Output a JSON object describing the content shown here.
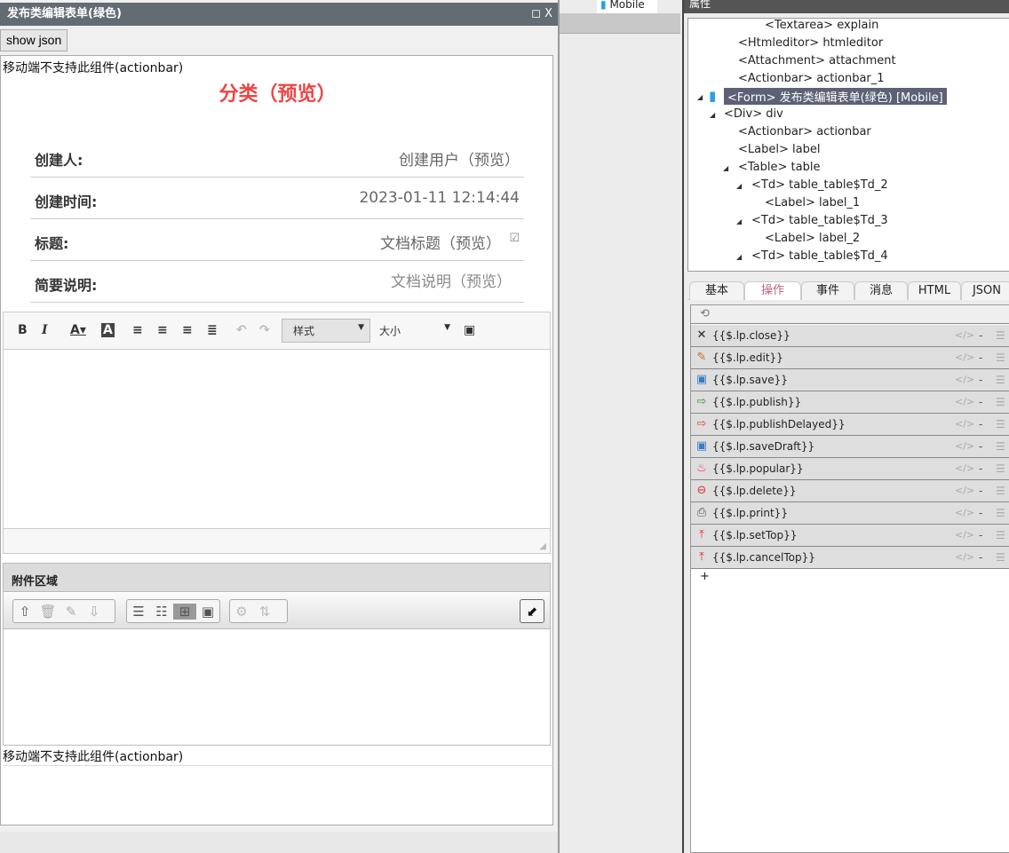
{
  "dialog": {
    "title": "发布类编辑表单(绿色)",
    "controls": "◻ X",
    "show_json": "show json",
    "mobile_note_top": "移动端不支持此组件(actionbar)",
    "mobile_note_bottom": "移动端不支持此组件(actionbar)",
    "category_title": "分类（预览）",
    "rows": [
      {
        "label": "创建人:",
        "value": "创建用户（预览）"
      },
      {
        "label": "创建时间:",
        "value": "2023-01-11 12:14:44"
      },
      {
        "label": "标题:",
        "value": "文档标题（预览）"
      },
      {
        "label": "简要说明:",
        "value": "文档说明（预览）"
      }
    ],
    "editor": {
      "style_label": "样式",
      "size_label": "大小"
    },
    "attachment": {
      "title": "附件区域"
    }
  },
  "mid": {
    "mobile_tab": "Mobile"
  },
  "panel": {
    "title": "属性",
    "tree": [
      "<Textarea> explain",
      "<Htmleditor> htmleditor",
      "<Attachment> attachment",
      "<Actionbar> actionbar_1",
      "<Form> 发布类编辑表单(绿色) [Mobile]",
      "<Div> div",
      "<Actionbar> actionbar",
      "<Label> label",
      "<Table> table",
      "<Td> table_table$Td_2",
      "<Label> label_1",
      "<Td> table_table$Td_3",
      "<Label> label_2",
      "<Td> table_table$Td_4"
    ],
    "tabs": [
      "基本",
      "操作",
      "事件",
      "消息",
      "HTML",
      "JSON"
    ],
    "active_tab": "操作",
    "actions": [
      {
        "name": "{{$.lp.close}}",
        "icon": "close-icon"
      },
      {
        "name": "{{$.lp.edit}}",
        "icon": "pencil-icon"
      },
      {
        "name": "{{$.lp.save}}",
        "icon": "save-icon"
      },
      {
        "name": "{{$.lp.publish}}",
        "icon": "publish-icon"
      },
      {
        "name": "{{$.lp.publishDelayed}}",
        "icon": "publish-delayed-icon"
      },
      {
        "name": "{{$.lp.saveDraft}}",
        "icon": "save-icon"
      },
      {
        "name": "{{$.lp.popular}}",
        "icon": "fire-icon"
      },
      {
        "name": "{{$.lp.delete}}",
        "icon": "delete-icon"
      },
      {
        "name": "{{$.lp.print}}",
        "icon": "print-icon"
      },
      {
        "name": "{{$.lp.setTop}}",
        "icon": "set-top-icon"
      },
      {
        "name": "{{$.lp.cancelTop}}",
        "icon": "cancel-top-icon"
      }
    ],
    "code_label": "</>",
    "dash": "-",
    "add": "+"
  }
}
